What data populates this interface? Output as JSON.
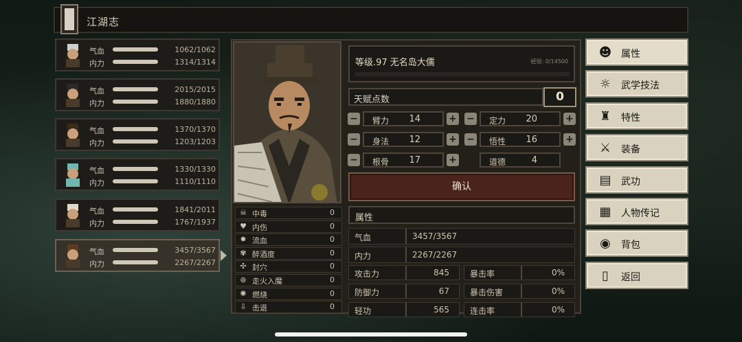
{
  "window": {
    "title": "江湖志"
  },
  "characters": [
    {
      "hp_label": "气血",
      "hp": "1062/1062",
      "mp_label": "内力",
      "mp": "1314/1314"
    },
    {
      "hp_label": "气血",
      "hp": "2015/2015",
      "mp_label": "内力",
      "mp": "1880/1880"
    },
    {
      "hp_label": "气血",
      "hp": "1370/1370",
      "mp_label": "内力",
      "mp": "1203/1203"
    },
    {
      "hp_label": "气血",
      "hp": "1330/1330",
      "mp_label": "内力",
      "mp": "1110/1110"
    },
    {
      "hp_label": "气血",
      "hp": "1841/2011",
      "mp_label": "内力",
      "mp": "1767/1937"
    },
    {
      "hp_label": "气血",
      "hp": "3457/3567",
      "mp_label": "内力",
      "mp": "2267/2267"
    }
  ],
  "hero": {
    "level_text": "等级.97  无名岛大儒",
    "exp_text": "经验: 0/14500",
    "talent_label": "天赋点数",
    "talent_points": "0"
  },
  "base_stats": [
    {
      "label": "臂力",
      "value": "14"
    },
    {
      "label": "定力",
      "value": "20"
    },
    {
      "label": "身法",
      "value": "12"
    },
    {
      "label": "悟性",
      "value": "16"
    },
    {
      "label": "根骨",
      "value": "17"
    },
    {
      "label": "道德",
      "value": "4"
    }
  ],
  "confirm_label": "确认",
  "statuses": [
    {
      "icon": "poison-icon",
      "label": "中毒",
      "value": "0"
    },
    {
      "icon": "broken-heart-icon",
      "label": "内伤",
      "value": "0"
    },
    {
      "icon": "bleed-icon",
      "label": "流血",
      "value": "0"
    },
    {
      "icon": "drunk-icon",
      "label": "醉酒度",
      "value": "0"
    },
    {
      "icon": "seal-icon",
      "label": "封穴",
      "value": "0"
    },
    {
      "icon": "madness-icon",
      "label": "走火入魔",
      "value": "0"
    },
    {
      "icon": "fire-icon",
      "label": "燃烧",
      "value": "0"
    },
    {
      "icon": "knockback-icon",
      "label": "击退",
      "value": "0"
    }
  ],
  "attributes": {
    "header": "属性",
    "hp_label": "气血",
    "hp": "3457/3567",
    "mp_label": "内力",
    "mp": "2267/2267",
    "combat": [
      {
        "label": "攻击力",
        "value": "845",
        "label2": "暴击率",
        "value2": "0%"
      },
      {
        "label": "防御力",
        "value": "67",
        "label2": "暴击伤害",
        "value2": "0%"
      },
      {
        "label": "轻功",
        "value": "565",
        "label2": "连击率",
        "value2": "0%"
      }
    ]
  },
  "menu": [
    {
      "icon": "person-icon",
      "label": "属性"
    },
    {
      "icon": "martial-skill-icon",
      "label": "武学技法"
    },
    {
      "icon": "trait-icon",
      "label": "特性"
    },
    {
      "icon": "sword-icon",
      "label": "装备"
    },
    {
      "icon": "scroll-icon",
      "label": "武功"
    },
    {
      "icon": "biography-icon",
      "label": "人物传记"
    },
    {
      "icon": "bag-icon",
      "label": "背包"
    },
    {
      "icon": "door-icon",
      "label": "返回"
    }
  ]
}
